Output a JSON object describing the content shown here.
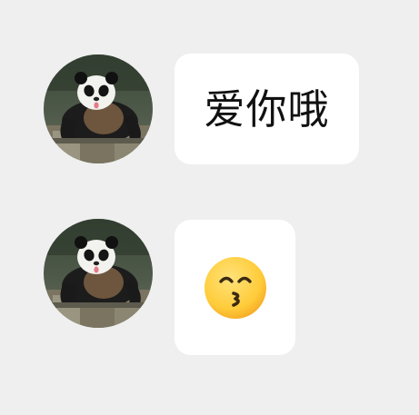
{
  "chat": {
    "messages": [
      {
        "sender": "panda",
        "type": "text",
        "text": "爱你哦",
        "avatar_icon": "panda-avatar-icon"
      },
      {
        "sender": "panda",
        "type": "emoji",
        "emoji": "kissing-face-with-smiling-eyes",
        "avatar_icon": "panda-avatar-icon"
      }
    ]
  },
  "colors": {
    "background": "#efefef",
    "bubble": "#ffffff",
    "text": "#111111",
    "emoji_face": "#ffcc3a"
  }
}
